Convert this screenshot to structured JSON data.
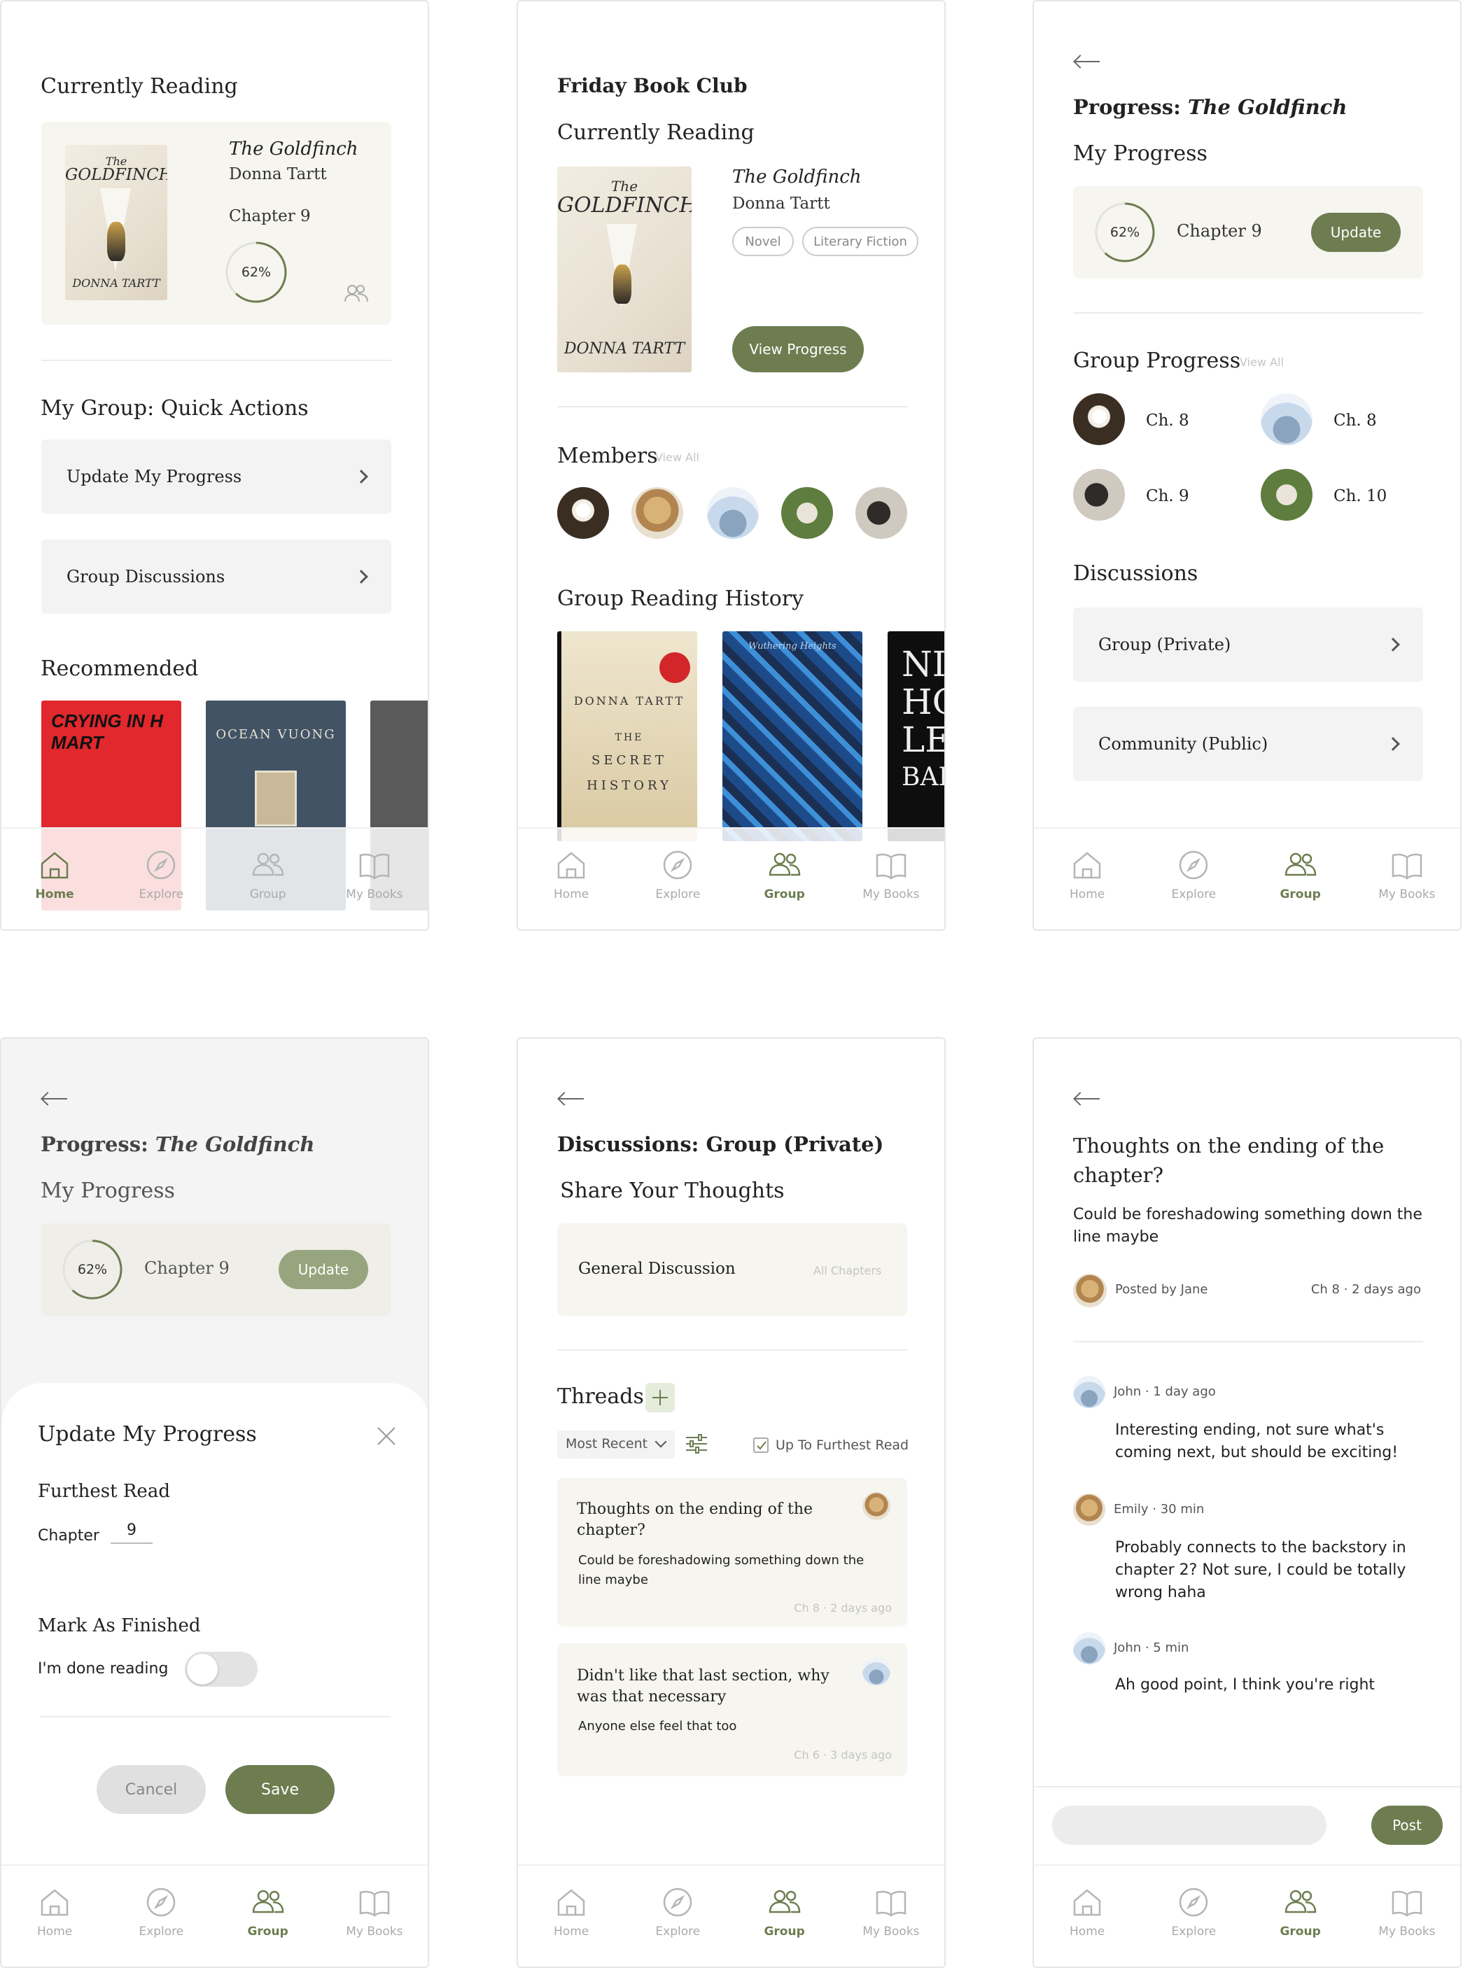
{
  "screens": {
    "home": {
      "currently_reading": "Currently Reading",
      "book_title": "The Goldfinch",
      "book_author": "Donna Tartt",
      "chapter": "Chapter 9",
      "progress": "62%",
      "progress_fraction": 0.62,
      "quick_actions_title": "My Group: Quick Actions",
      "actions": [
        "Update My Progress",
        "Group Discussions"
      ],
      "recommended_title": "Recommended",
      "rec_books": [
        {
          "text": "CRYING IN H MART",
          "color": "#e0282d"
        },
        {
          "text": "OCEAN VUONG",
          "color": "#415365"
        },
        {
          "text": "",
          "color": "#5a5a5a"
        }
      ]
    },
    "club": {
      "title": "Friday Book Club",
      "currently_reading": "Currently Reading",
      "book_title": "The Goldfinch",
      "book_author": "Donna Tartt",
      "tags": [
        "Novel",
        "Literary Fiction"
      ],
      "view_progress": "View Progress",
      "members_title": "Members",
      "view_all": "View All",
      "history_title": "Group Reading History",
      "history_books": [
        {
          "lines": [
            "DONNA TARTT",
            "THE",
            "SECRET",
            "HISTORY"
          ]
        },
        {
          "lines": [
            "Wuthering Heights"
          ]
        },
        {
          "lines": [
            "NI",
            "HO",
            "LE",
            "BAR"
          ]
        }
      ]
    },
    "progress": {
      "title_prefix": "Progress: ",
      "title_book": "The Goldfinch",
      "my_progress": "My Progress",
      "progress": "62%",
      "progress_fraction": 0.62,
      "chapter": "Chapter 9",
      "update": "Update",
      "group_progress": "Group Progress",
      "view_all": "View All",
      "members": [
        {
          "ch": "Ch. 8",
          "avatar": "flower"
        },
        {
          "ch": "Ch. 8",
          "avatar": "sky"
        },
        {
          "ch": "Ch. 9",
          "avatar": "horse"
        },
        {
          "ch": "Ch. 10",
          "avatar": "sheep"
        }
      ],
      "discussions": "Discussions",
      "disc_items": [
        "Group (Private)",
        "Community (Public)"
      ]
    },
    "update_sheet": {
      "title": "Update My Progress",
      "furthest_read": "Furthest Read",
      "chapter_label": "Chapter",
      "chapter_value": "9",
      "mark_finished": "Mark As Finished",
      "done_reading": "I'm done reading",
      "cancel": "Cancel",
      "save": "Save"
    },
    "discussions": {
      "title": "Discussions: Group (Private)",
      "share": "Share Your Thoughts",
      "general": "General Discussion",
      "all_chapters": "All Chapters",
      "threads": "Threads",
      "sort": "Most Recent",
      "furthest_filter": "Up To Furthest Read",
      "thread_items": [
        {
          "title": "Thoughts on the ending of the chapter?",
          "body": "Could be foreshadowing something down the line maybe",
          "meta": "Ch 8 · 2 days ago"
        },
        {
          "title": "Didn't like that last section, why was that necessary",
          "body": "Anyone else feel that too",
          "meta": "Ch 6 · 3 days ago"
        }
      ]
    },
    "thread": {
      "title": "Thoughts on the ending of the chapter?",
      "body": "Could be foreshadowing something down the line maybe",
      "posted_by": "Posted by Jane",
      "meta": "Ch 8 · 2 days ago",
      "comments": [
        {
          "author": "John · 1 day ago",
          "text": "Interesting ending, not sure what's coming next, but should be exciting!"
        },
        {
          "author": "Emily · 30 min",
          "text": "Probably connects to the backstory in chapter 2? Not sure, I could be totally wrong haha"
        },
        {
          "author": "John · 5 min",
          "text": "Ah good point, I think you're right"
        }
      ],
      "post": "Post"
    }
  },
  "tabs": [
    "Home",
    "Explore",
    "Group",
    "My Books"
  ],
  "cover_text": {
    "the": "The",
    "goldfinch": "GOLDFINCH",
    "author": "DONNA TARTT"
  }
}
